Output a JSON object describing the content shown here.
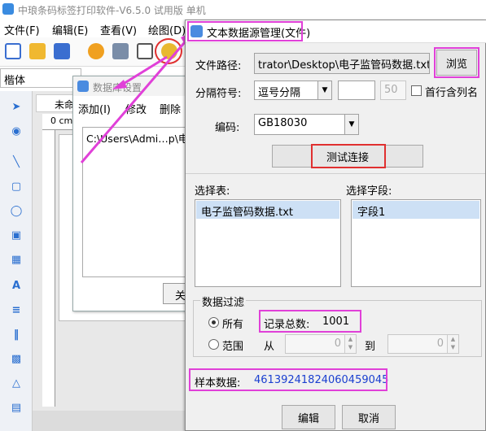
{
  "app": {
    "title": "中琅条码标签打印软件-V6.5.0 试用版 单机",
    "menu": [
      "文件(F)",
      "编辑(E)",
      "查看(V)",
      "绘图(D)"
    ],
    "font_name": "楷体",
    "doc_tab": "未命",
    "ruler_label": "0 cm"
  },
  "db_dialog": {
    "title": "数据库设置",
    "menu": [
      "添加(I)",
      "修改",
      "删除"
    ],
    "list_item": "C:\\Users\\Admi…p\\电",
    "button": "关"
  },
  "text_source_dialog": {
    "title": "文本数据源管理(文件)",
    "file_path_label": "文件路径:",
    "file_path_value": "trator\\Desktop\\电子监管码数据.txt",
    "browse_button": "浏览",
    "separator_label": "分隔符号:",
    "separator_value": "逗号分隔",
    "separator_custom_value": "",
    "separator_number": "50",
    "first_row_header_label": "首行含列名",
    "first_row_header_checked": false,
    "encoding_label": "编码:",
    "encoding_value": "GB18030",
    "test_button": "测试连接",
    "select_table_label": "选择表:",
    "tables": [
      "电子监管码数据.txt"
    ],
    "select_field_label": "选择字段:",
    "fields": [
      "字段1"
    ],
    "filter_title": "数据过滤",
    "all_label": "所有",
    "all_selected": true,
    "record_total_label": "记录总数:",
    "record_total_value": "1001",
    "range_label": "范围",
    "from_label": "从",
    "from_value": "0",
    "to_label": "到",
    "to_value": "0",
    "sample_label": "样本数据:",
    "sample_value": "46139241824060459045",
    "edit_button": "编辑",
    "cancel_button": "取消"
  },
  "colors": {
    "highlight_magenta": "#e040d8",
    "highlight_red": "#e03030",
    "selection": "#cde0f5",
    "sample_text": "#1a3fd0"
  }
}
